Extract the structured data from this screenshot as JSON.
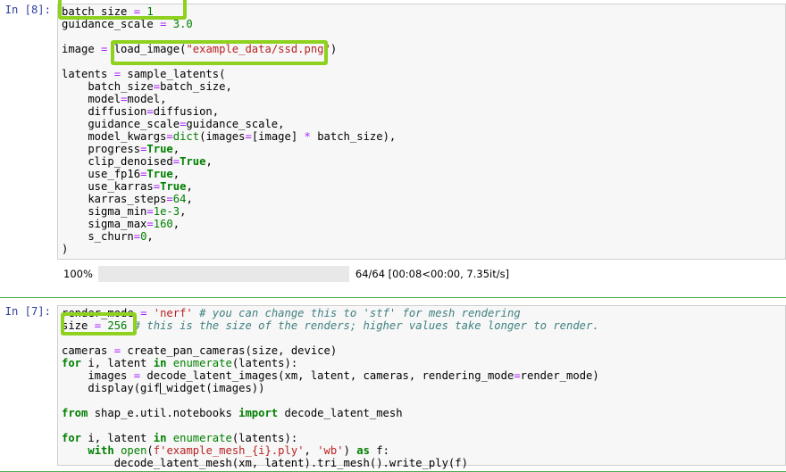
{
  "cells": [
    {
      "prompt": "In [8]:",
      "code_lines": [
        "batch_size = 1",
        "guidance_scale = 3.0",
        "",
        "image = load_image(\"example_data/ssd.png\")",
        "",
        "latents = sample_latents(",
        "    batch_size=batch_size,",
        "    model=model,",
        "    diffusion=diffusion,",
        "    guidance_scale=guidance_scale,",
        "    model_kwargs=dict(images=[image] * batch_size),",
        "    progress=True,",
        "    clip_denoised=True,",
        "    use_fp16=True,",
        "    use_karras=True,",
        "    karras_steps=64,",
        "    sigma_min=1e-3,",
        "    sigma_max=160,",
        "    s_churn=0,",
        ")"
      ],
      "output": {
        "type": "progress-bar",
        "percent_label": "100%",
        "percent_value": 100,
        "meta": "64/64 [00:08<00:00, 7.35it/s]",
        "bar_color": "#4caf50"
      }
    },
    {
      "prompt": "In [7]:",
      "selected": true,
      "code_lines": [
        "render_mode = 'nerf' # you can change this to 'stf' for mesh rendering",
        "size = 256 # this is the size of the renders; higher values take longer to render.",
        "",
        "cameras = create_pan_cameras(size, device)",
        "for i, latent in enumerate(latents):",
        "    images = decode_latent_images(xm, latent, cameras, rendering_mode=render_mode)",
        "    display(gif_widget(images))",
        "",
        "from shap_e.util.notebooks import decode_latent_mesh",
        "",
        "for i, latent in enumerate(latents):",
        "    with open(f'example_mesh_{i}.ply', 'wb') as f:",
        "        decode_latent_mesh(xm, latent).tri_mesh().write_ply(f)"
      ]
    }
  ],
  "highlights": [
    {
      "label": "batch_size = 1",
      "target": "cell1-line1"
    },
    {
      "label": "load_image(\"example_data/ssd.png\")",
      "target": "cell1-line4-call"
    },
    {
      "label": "size = 256",
      "target": "cell2-line2"
    }
  ],
  "colors": {
    "highlight_green": "#8ed11e",
    "selected_cell_border": "#4caf50",
    "progress_fill": "#4caf50",
    "prompt_blue": "#303f9f",
    "string_red": "#ba2121",
    "keyword_green": "#008000",
    "comment_teal": "#408080",
    "operator_purple": "#aa22ff",
    "code_background": "#f7f7f7"
  }
}
